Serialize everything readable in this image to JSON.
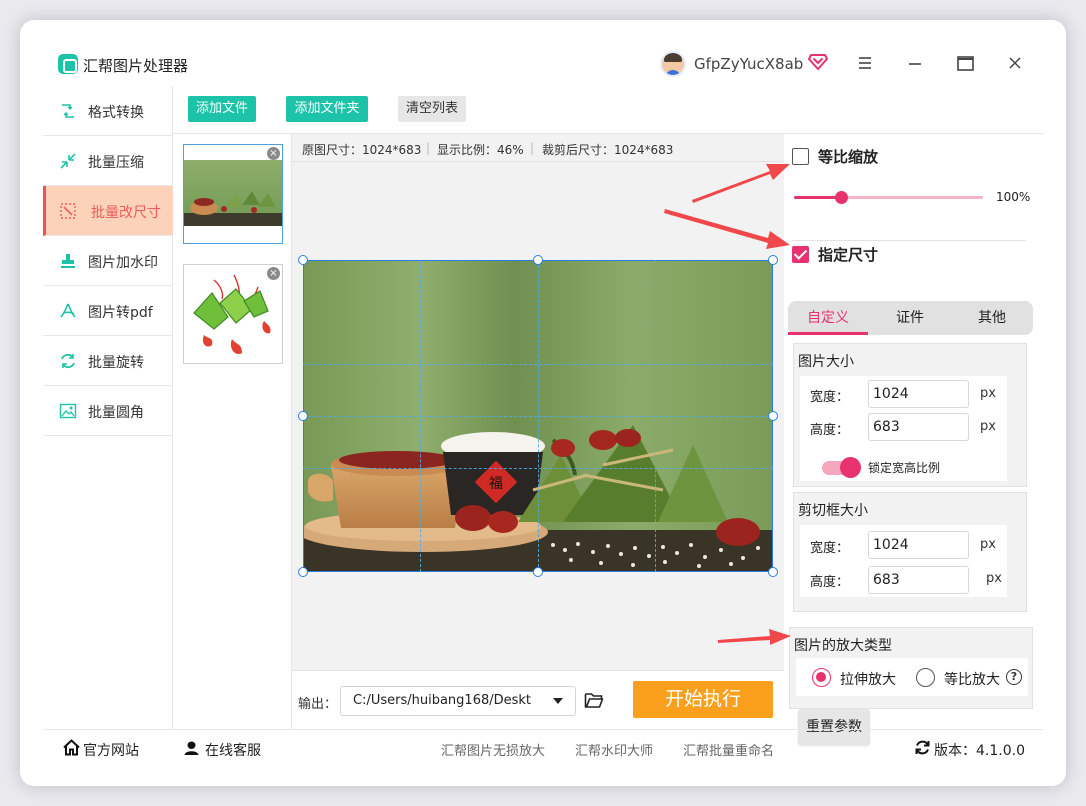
{
  "app": {
    "title": "汇帮图片处理器",
    "username": "GfpZyYucX8ab"
  },
  "sidebar": {
    "items": [
      {
        "label": "格式转换",
        "icon": "format-convert-icon"
      },
      {
        "label": "批量压缩",
        "icon": "compress-icon"
      },
      {
        "label": "批量改尺寸",
        "icon": "resize-icon",
        "active": true
      },
      {
        "label": "图片加水印",
        "icon": "watermark-icon"
      },
      {
        "label": "图片转pdf",
        "icon": "pdf-icon"
      },
      {
        "label": "批量旋转",
        "icon": "rotate-icon"
      },
      {
        "label": "批量圆角",
        "icon": "image-icon"
      }
    ]
  },
  "toolbar": {
    "add_file": "添加文件",
    "add_folder": "添加文件夹",
    "clear_list": "清空列表"
  },
  "preview": {
    "original_size": "原图尺寸：1024*683",
    "display_ratio": "显示比例：46%",
    "cropped_size": "裁剪后尺寸：1024*683",
    "separator": "|"
  },
  "output": {
    "label": "输出：",
    "path": "C:/Users/huibang168/Deskt",
    "start_button": "开始执行"
  },
  "settings": {
    "proportional_scale": {
      "label": "等比缩放",
      "checked": false
    },
    "scale_slider": {
      "value": 0.25,
      "label": "100%"
    },
    "specify_size": {
      "label": "指定尺寸",
      "checked": true
    },
    "tabs": [
      "自定义",
      "证件",
      "其他"
    ],
    "image_size": {
      "title": "图片大小",
      "width_label": "宽度：",
      "width_value": "1024",
      "height_label": "高度：",
      "height_value": "683",
      "unit": "px",
      "lock_label": "锁定宽高比例"
    },
    "crop_size": {
      "title": "剪切框大小",
      "width_label": "宽度：",
      "width_value": "1024",
      "height_label": "高度：",
      "height_value": "683",
      "unit": "px"
    },
    "enlarge_type": {
      "title": "图片的放大类型",
      "option_stretch": "拉伸放大",
      "option_proportional": "等比放大",
      "help": "?"
    },
    "reset_button": "重置参数"
  },
  "footer": {
    "official_site": "官方网站",
    "online_service": "在线客服",
    "promo1": "汇帮图片无损放大",
    "promo2": "汇帮水印大师",
    "promo3": "汇帮批量重命名",
    "version": "版本：4.1.0.0"
  },
  "colors": {
    "accent": "#e8326d",
    "teal": "#1cc3a8",
    "orange": "#fba01c",
    "active_nav_bg": "#fcd3b8",
    "arrow": "#f0484a"
  }
}
